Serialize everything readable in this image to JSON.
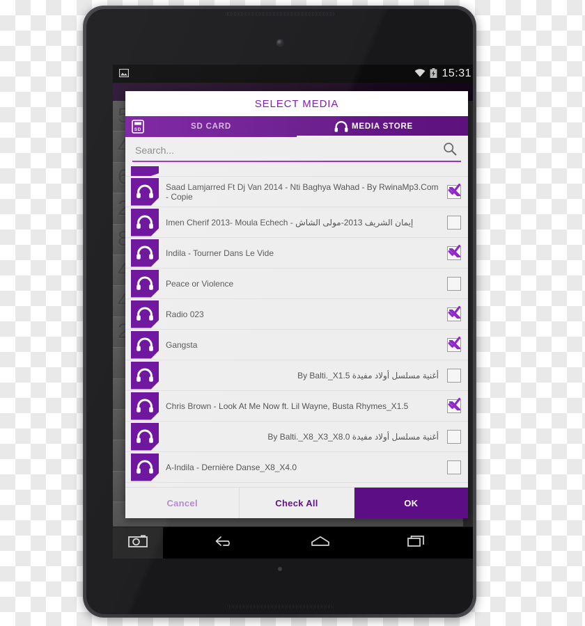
{
  "status_bar": {
    "notification_icon": "image-icon",
    "wifi_icon": "wifi-icon",
    "battery_icon": "battery-charging-icon",
    "clock": "15:31"
  },
  "dialog": {
    "title": "SELECT MEDIA",
    "tabs": [
      {
        "label": "SD CARD",
        "icon": "sd-card-icon",
        "active": false
      },
      {
        "label": "MEDIA STORE",
        "icon": "headphones-icon",
        "active": true
      }
    ],
    "search": {
      "placeholder": "Search...",
      "value": "",
      "icon": "search-icon"
    },
    "list": [
      {
        "title": "Saad Lamjarred Ft Dj Van 2014 - Nti Baghya Wahad - By RwinaMp3.Com - Copie",
        "checked": true,
        "rtl": false,
        "icon": "headphones-icon"
      },
      {
        "title": "Imen Cherif 2013- Moula Echech - إيمان الشريف 2013-مولى الشاش",
        "checked": false,
        "rtl": false,
        "icon": "headphones-icon"
      },
      {
        "title": "Indila - Tourner Dans Le Vide",
        "checked": true,
        "rtl": false,
        "icon": "headphones-icon"
      },
      {
        "title": "Peace or Violence",
        "checked": false,
        "rtl": false,
        "icon": "headphones-icon"
      },
      {
        "title": "Radio 023",
        "checked": true,
        "rtl": false,
        "icon": "headphones-icon"
      },
      {
        "title": "Gangsta",
        "checked": true,
        "rtl": false,
        "icon": "headphones-icon"
      },
      {
        "title": "أغنية مسلسل أولاد مفيدة By Balti._X1.5",
        "checked": false,
        "rtl": true,
        "icon": "headphones-icon"
      },
      {
        "title": "Chris Brown - Look At Me Now ft. Lil Wayne, Busta Rhymes_X1.5",
        "checked": true,
        "rtl": false,
        "icon": "headphones-icon"
      },
      {
        "title": "أغنية مسلسل أولاد مفيدة By Balti._X8_X3_X8.0",
        "checked": false,
        "rtl": true,
        "icon": "headphones-icon"
      },
      {
        "title": "A-Indila - Dernière Danse_X8_X4.0",
        "checked": false,
        "rtl": false,
        "icon": "headphones-icon"
      }
    ],
    "buttons": {
      "cancel": "Cancel",
      "check_all": "Check All",
      "ok": "OK"
    }
  },
  "background_app": {
    "rows": [
      {
        "number": "5",
        "percent": "%"
      },
      {
        "number": "4",
        "percent": "%"
      },
      {
        "number": "6",
        "percent": "%"
      },
      {
        "number": "2",
        "percent": "%"
      },
      {
        "number": "8",
        "percent": "%"
      },
      {
        "number": "4",
        "percent": "%"
      },
      {
        "number": "4",
        "percent": "%"
      },
      {
        "number": "2",
        "percent": "%"
      },
      {
        "number": "",
        "percent": "%"
      },
      {
        "number": "",
        "percent": "%"
      },
      {
        "number": "",
        "percent": "%"
      },
      {
        "number": "",
        "percent": "%"
      },
      {
        "number": "",
        "percent": "%"
      },
      {
        "number": "",
        "percent": "%"
      }
    ]
  },
  "nav_bar": {
    "camera_icon": "camera-icon",
    "back_icon": "back-arrow-icon",
    "home_icon": "home-icon",
    "recents_icon": "recent-apps-icon"
  },
  "colors": {
    "accent_purple": "#7b1fa2",
    "deep_purple": "#5c0f85",
    "title_purple": "#7b18a8",
    "dialog_bg": "#eeeeee",
    "thumb_purple": "#6a0f9b"
  }
}
